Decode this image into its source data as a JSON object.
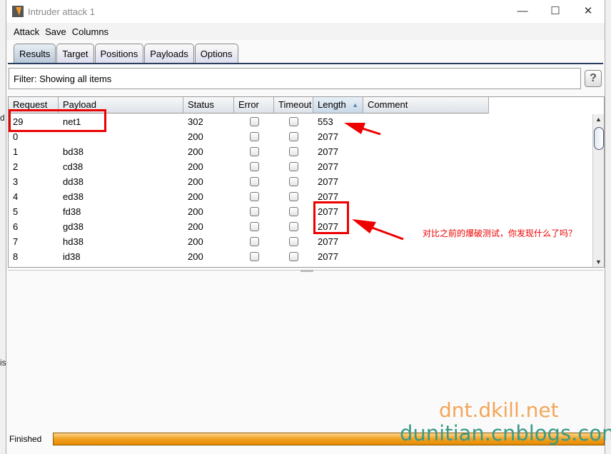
{
  "window": {
    "title": "Intruder attack 1",
    "controls": [
      "—",
      "☐",
      "✕"
    ]
  },
  "background_text": {
    "a": "d",
    "b": "is"
  },
  "menu": [
    "Attack",
    "Save",
    "Columns"
  ],
  "tabs": [
    {
      "label": "Results",
      "active": true
    },
    {
      "label": "Target"
    },
    {
      "label": "Positions"
    },
    {
      "label": "Payloads"
    },
    {
      "label": "Options"
    }
  ],
  "filter": {
    "text": "Filter: Showing all items",
    "help": "?"
  },
  "table": {
    "columns": [
      "Request",
      "Payload",
      "Status",
      "Error",
      "Timeout",
      "Length",
      "Comment"
    ],
    "sorted_column": "Length",
    "sort_indicator": "▲",
    "rows": [
      {
        "request": "29",
        "payload": "net1",
        "status": "302",
        "error": false,
        "timeout": false,
        "length": "553",
        "comment": ""
      },
      {
        "request": "0",
        "payload": "",
        "status": "200",
        "error": false,
        "timeout": false,
        "length": "2077",
        "comment": ""
      },
      {
        "request": "1",
        "payload": "bd38",
        "status": "200",
        "error": false,
        "timeout": false,
        "length": "2077",
        "comment": ""
      },
      {
        "request": "2",
        "payload": "cd38",
        "status": "200",
        "error": false,
        "timeout": false,
        "length": "2077",
        "comment": ""
      },
      {
        "request": "3",
        "payload": "dd38",
        "status": "200",
        "error": false,
        "timeout": false,
        "length": "2077",
        "comment": ""
      },
      {
        "request": "4",
        "payload": "ed38",
        "status": "200",
        "error": false,
        "timeout": false,
        "length": "2077",
        "comment": ""
      },
      {
        "request": "5",
        "payload": "fd38",
        "status": "200",
        "error": false,
        "timeout": false,
        "length": "2077",
        "comment": ""
      },
      {
        "request": "6",
        "payload": "gd38",
        "status": "200",
        "error": false,
        "timeout": false,
        "length": "2077",
        "comment": ""
      },
      {
        "request": "7",
        "payload": "hd38",
        "status": "200",
        "error": false,
        "timeout": false,
        "length": "2077",
        "comment": ""
      },
      {
        "request": "8",
        "payload": "id38",
        "status": "200",
        "error": false,
        "timeout": false,
        "length": "2077",
        "comment": ""
      }
    ]
  },
  "annotation": {
    "note": "对比之前的爆破测试，你发现什么了吗？",
    "color": "#e00000"
  },
  "status": {
    "text": "Finished",
    "progress": 1.0
  },
  "watermark": {
    "line1": "dnt.dkill.net",
    "line2": "dunitian.cnblogs.com"
  }
}
